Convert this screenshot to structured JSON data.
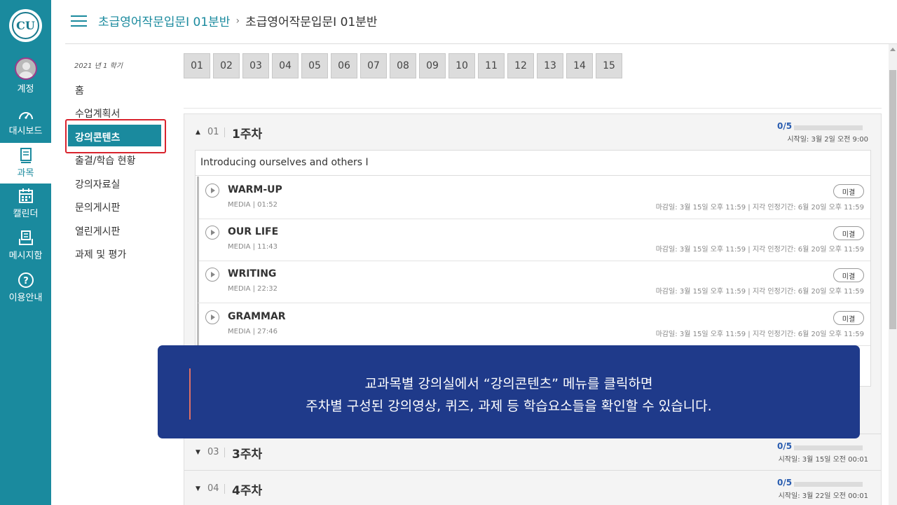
{
  "global_nav": {
    "logo_text": "CU",
    "items": [
      {
        "label": "계정",
        "icon": "account-avatar"
      },
      {
        "label": "대시보드",
        "icon": "dashboard-icon"
      },
      {
        "label": "과목",
        "icon": "courses-icon"
      },
      {
        "label": "캘린더",
        "icon": "calendar-icon"
      },
      {
        "label": "메시지함",
        "icon": "inbox-icon"
      },
      {
        "label": "이용안내",
        "icon": "help-icon"
      }
    ],
    "active": "과목"
  },
  "breadcrumb": {
    "link": "초급영어작문입문Ⅰ 01분반",
    "separator": "›",
    "current": "초급영어작문입문Ⅰ 01분반"
  },
  "course_nav": {
    "term": "2021 년 1 학기",
    "items": [
      "홈",
      "수업계획서",
      "강의콘텐츠",
      "출결/학습 현황",
      "강의자료실",
      "문의게시판",
      "열린게시판",
      "과제 및 평가"
    ],
    "active": "강의콘텐츠"
  },
  "week_buttons": [
    "01",
    "02",
    "03",
    "04",
    "05",
    "06",
    "07",
    "08",
    "09",
    "10",
    "11",
    "12",
    "13",
    "14",
    "15"
  ],
  "weeks": [
    {
      "toggle": "▲",
      "num": "01",
      "title": "1주차",
      "progress": "0/5",
      "progress_fraction": 0,
      "start": "시작일:  3월 2일 오전 9:00"
    },
    {
      "toggle": "▼",
      "num": "03",
      "title": "3주차",
      "progress": "0/5",
      "progress_fraction": 0,
      "start": "시작일:  3월 15일 오전 00:01"
    },
    {
      "toggle": "▼",
      "num": "04",
      "title": "4주차",
      "progress": "0/5",
      "progress_fraction": 0,
      "start": "시작일:  3월 22일 오전 00:01"
    }
  ],
  "section": {
    "title": "Introducing ourselves and others I",
    "items": [
      {
        "name": "WARM-UP",
        "meta": "MEDIA  |  01:52",
        "status": "미결",
        "due": "마감일: 3월 15일 오후 11:59  |   지각 인정기간: 6월 20일 오후 11:59"
      },
      {
        "name": "OUR LIFE",
        "meta": "MEDIA  |  11:43",
        "status": "미결",
        "due": "마감일: 3월 15일 오후 11:59  |   지각 인정기간: 6월 20일 오후 11:59"
      },
      {
        "name": "WRITING",
        "meta": "MEDIA  |  22:32",
        "status": "미결",
        "due": "마감일: 3월 15일 오후 11:59  |   지각 인정기간: 6월 20일 오후 11:59"
      },
      {
        "name": "GRAMMAR",
        "meta": "MEDIA  |  27:46",
        "status": "미결",
        "due": "마감일: 3월 15일 오후 11:59  |   지각 인정기간: 6월 20일 오후 11:59"
      }
    ]
  },
  "notice": {
    "line1": "교과목별 강의실에서 “강의콘텐츠” 메뉴를 클릭하면",
    "line2": "주차별 구성된 강의영상, 퀴즈, 과제 등 학습요소들을 확인할 수 있습니다."
  },
  "colors": {
    "brand": "#1a8a9e",
    "highlight": "#d9232d",
    "notice_bg": "#1f3a8a",
    "progress_text": "#2a5db0"
  }
}
